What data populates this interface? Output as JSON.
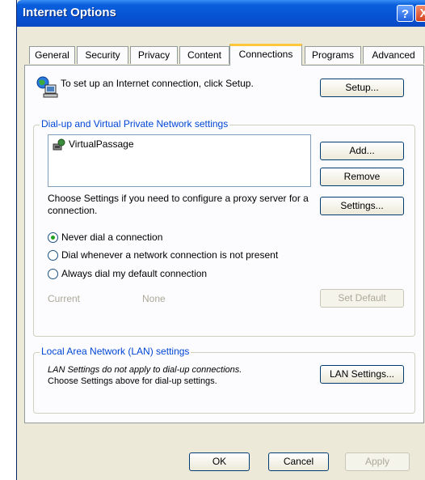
{
  "window": {
    "title": "Internet Options"
  },
  "title_buttons": {
    "help": "?",
    "close": "X"
  },
  "tabs": [
    {
      "label": "General"
    },
    {
      "label": "Security"
    },
    {
      "label": "Privacy"
    },
    {
      "label": "Content"
    },
    {
      "label": "Connections",
      "active": true
    },
    {
      "label": "Programs"
    },
    {
      "label": "Advanced"
    }
  ],
  "setup": {
    "text": "To set up an Internet connection, click Setup.",
    "button": "Setup..."
  },
  "dialup": {
    "group_title": "Dial-up and Virtual Private Network settings",
    "connections": [
      "VirtualPassage"
    ],
    "add_button": "Add...",
    "remove_button": "Remove",
    "settings_text": "Choose Settings if you need to configure a proxy server for a connection.",
    "settings_button": "Settings...",
    "radio_options": [
      {
        "label": "Never dial a connection",
        "selected": true
      },
      {
        "label": "Dial whenever a network connection is not present",
        "selected": false
      },
      {
        "label": "Always dial my default connection",
        "selected": false
      }
    ],
    "current_label": "Current",
    "current_value": "None",
    "set_default_button": "Set Default"
  },
  "lan": {
    "group_title": "Local Area Network (LAN) settings",
    "text_line1": "LAN Settings do not apply to dial-up connections.",
    "text_line2": "Choose Settings above for dial-up settings.",
    "button": "LAN Settings..."
  },
  "footer": {
    "ok": "OK",
    "cancel": "Cancel",
    "apply": "Apply"
  },
  "colors": {
    "titlebar": "#0653d4",
    "group_title": "#0046d5",
    "active_tab_highlight": "#ffc83c",
    "radio_selected": "#21a121"
  }
}
